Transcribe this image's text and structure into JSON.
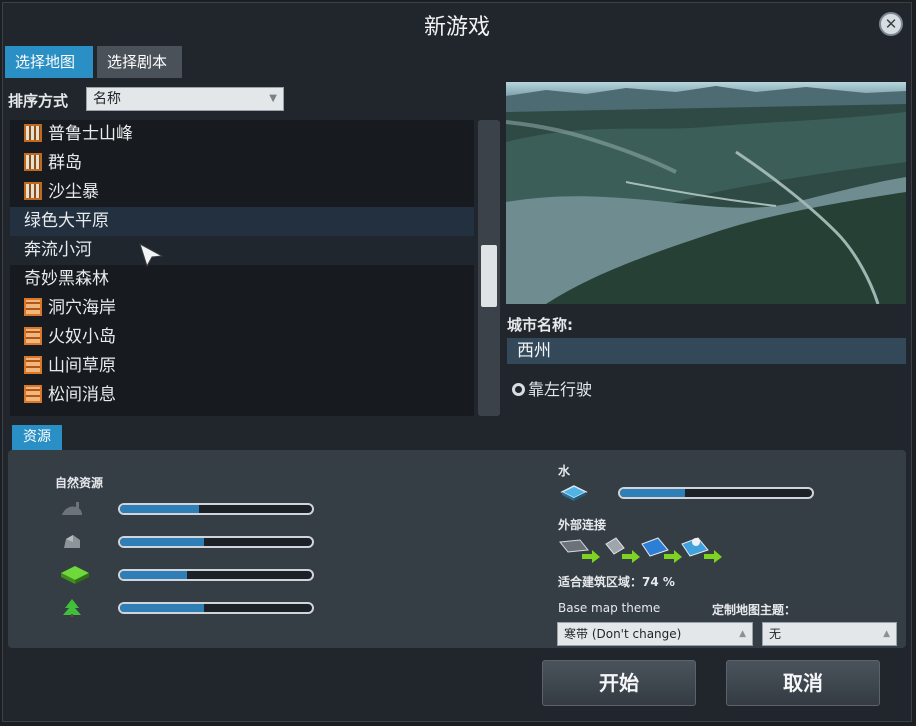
{
  "window": {
    "title": "新游戏"
  },
  "tabs": {
    "select_map": "选择地图",
    "select_scenario": "选择剧本"
  },
  "sort": {
    "label": "排序方式",
    "selected": "名称"
  },
  "maps": [
    {
      "name": "普鲁士山峰",
      "badge": "dust"
    },
    {
      "name": "群岛",
      "badge": "dust"
    },
    {
      "name": "沙尘暴",
      "badge": "dust"
    },
    {
      "name": "绿色大平原",
      "badge": "",
      "state": "selected"
    },
    {
      "name": "奔流小河",
      "badge": "",
      "state": "hover"
    },
    {
      "name": "奇妙黑森林",
      "badge": ""
    },
    {
      "name": "洞穴海岸",
      "badge": "brick"
    },
    {
      "name": "火奴小岛",
      "badge": "brick"
    },
    {
      "name": "山间草原",
      "badge": "brick"
    },
    {
      "name": "松间消息",
      "badge": "brick"
    }
  ],
  "city": {
    "label": "城市名称:",
    "value": "西州"
  },
  "traffic": {
    "label": "靠左行驶"
  },
  "resources": {
    "tab": "资源",
    "natural_title": "自然资源",
    "natural": [
      {
        "icon": "oil-icon",
        "level": 0.41
      },
      {
        "icon": "ore-icon",
        "level": 0.44
      },
      {
        "icon": "fertile-land-icon",
        "level": 0.35
      },
      {
        "icon": "forest-icon",
        "level": 0.44
      }
    ],
    "water_title": "水",
    "water_level": 0.34,
    "external_title": "外部连接",
    "buildable": "适合建筑区域：74 %",
    "base_theme_label": "Base map theme",
    "base_theme_value": "寒带 (Don't change)",
    "custom_theme_label": "定制地图主题：",
    "custom_theme_value": "无"
  },
  "buttons": {
    "start": "开始",
    "cancel": "取消"
  },
  "colors": {
    "accent": "#2a8fc4",
    "bar_fill": "#2f7fb6"
  }
}
